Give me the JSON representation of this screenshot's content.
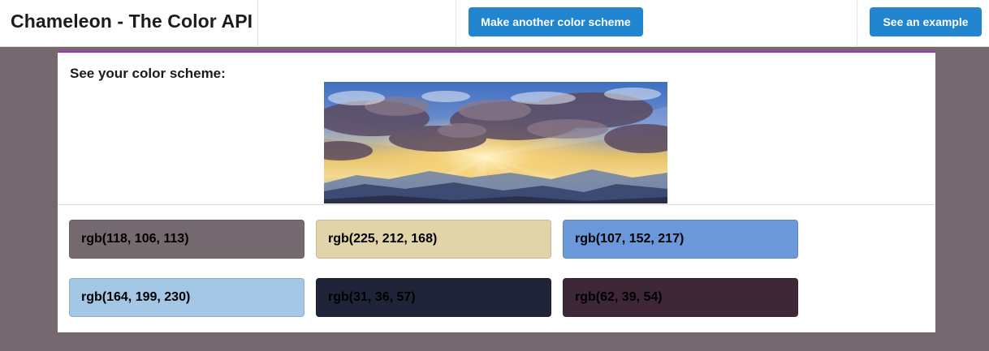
{
  "header": {
    "title": "Chameleon - The Color API",
    "make_scheme_label": "Make another color scheme",
    "example_label": "See an example"
  },
  "main": {
    "heading": "See your color scheme:",
    "image_alt": "Sunset over mountains with dramatic clouds",
    "swatches": [
      {
        "label": "rgb(118, 106, 113)",
        "color": "#766a71"
      },
      {
        "label": "rgb(225, 212, 168)",
        "color": "#e1d4a8"
      },
      {
        "label": "rgb(107, 152, 217)",
        "color": "#6b98d9"
      },
      {
        "label": "rgb(164, 199, 230)",
        "color": "#a4c7e6"
      },
      {
        "label": "rgb(31, 36, 57)",
        "color": "#1f2439"
      },
      {
        "label": "rgb(62, 39, 54)",
        "color": "#3e2736"
      }
    ]
  },
  "colors": {
    "accent": "#2185d0",
    "card_top_border": "#a333c8",
    "page_background": "#76686f"
  }
}
